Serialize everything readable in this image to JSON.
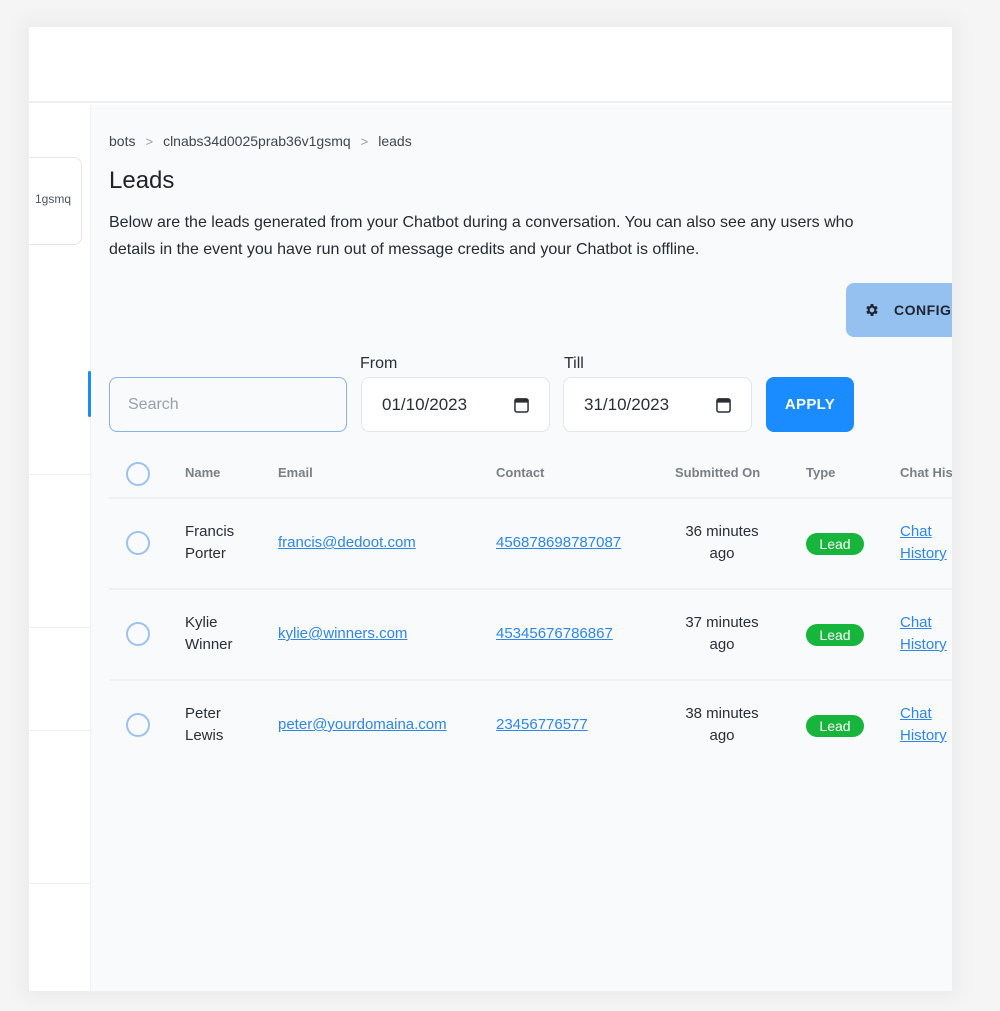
{
  "sidebar": {
    "bot_card_label": "1gsmq"
  },
  "breadcrumb": {
    "items": [
      "bots",
      "clnabs34d0025prab36v1gsmq",
      "leads"
    ],
    "separator": ">"
  },
  "page": {
    "title": "Leads",
    "description_line1": "Below are the leads generated from your Chatbot during a conversation. You can also see any users who",
    "description_line2": "details in the event you have run out of message credits and your Chatbot is offline."
  },
  "toolbar": {
    "config_label": "CONFIG",
    "config_icon": "gear-icon"
  },
  "filters": {
    "search_placeholder": "Search",
    "search_value": "",
    "from_label": "From",
    "from_value": "01/10/2023",
    "till_label": "Till",
    "till_value": "31/10/2023",
    "apply_label": "APPLY",
    "calendar_icon": "calendar-icon"
  },
  "table": {
    "columns": [
      "Name",
      "Email",
      "Contact",
      "Submitted On",
      "Type",
      "Chat History"
    ],
    "rows": [
      {
        "name_first": "Francis",
        "name_last": "Porter",
        "email": "francis@dedoot.com",
        "contact": "456878698787087",
        "submitted_line1": "36 minutes",
        "submitted_line2": "ago",
        "type": "Lead",
        "chat_line1": "Chat",
        "chat_line2": "History"
      },
      {
        "name_first": "Kylie",
        "name_last": "Winner",
        "email": "kylie@winners.com",
        "contact": "45345676786867",
        "submitted_line1": "37 minutes",
        "submitted_line2": "ago",
        "type": "Lead",
        "chat_line1": "Chat",
        "chat_line2": "History"
      },
      {
        "name_first": "Peter",
        "name_last": "Lewis",
        "email": "peter@yourdomaina.com",
        "contact": "23456776577",
        "submitted_line1": "38 minutes",
        "submitted_line2": "ago",
        "type": "Lead",
        "chat_line1": "Chat",
        "chat_line2": "History"
      }
    ]
  },
  "colors": {
    "accent": "#1a8cff",
    "config_button": "#94c1f0",
    "lead_badge": "#18b53d",
    "link": "#2e86e6"
  }
}
